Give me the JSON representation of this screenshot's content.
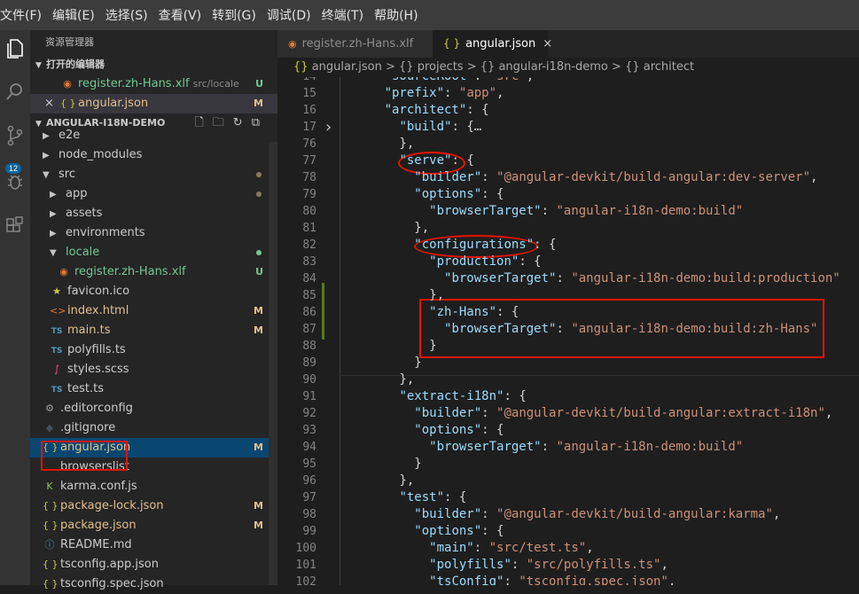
{
  "menu": [
    "文件(F)",
    "编辑(E)",
    "选择(S)",
    "查看(V)",
    "转到(G)",
    "调试(D)",
    "终端(T)",
    "帮助(H)"
  ],
  "activity_badge": "12",
  "sidebar": {
    "title": "资源管理器",
    "open_editors_label": "打开的编辑器",
    "open_editors": [
      {
        "icon": "rss-icon",
        "name": "register.zh-Hans.xlf",
        "path": "src/locale",
        "status": "U"
      },
      {
        "icon": "json-icon",
        "name": "angular.json",
        "status": "M"
      }
    ],
    "project_label": "ANGULAR-I18N-DEMO",
    "tree": [
      {
        "name": "e2e",
        "kind": "folder",
        "indent": 0
      },
      {
        "name": "node_modules",
        "kind": "folder",
        "indent": 0
      },
      {
        "name": "src",
        "kind": "folder-open",
        "indent": 0,
        "dot": "#8b7a55"
      },
      {
        "name": "app",
        "kind": "folder",
        "indent": 1,
        "dot": "#8b7a55"
      },
      {
        "name": "assets",
        "kind": "folder",
        "indent": 1
      },
      {
        "name": "environments",
        "kind": "folder",
        "indent": 1
      },
      {
        "name": "locale",
        "kind": "folder-open",
        "indent": 1,
        "dot": "#73c991",
        "color": "#73c991"
      },
      {
        "name": "register.zh-Hans.xlf",
        "kind": "rss",
        "indent": 2,
        "status": "U",
        "color": "#73c991"
      },
      {
        "name": "favicon.ico",
        "kind": "star",
        "indent": 1
      },
      {
        "name": "index.html",
        "kind": "html",
        "indent": 1,
        "status": "M",
        "color": "#e2c08d"
      },
      {
        "name": "main.ts",
        "kind": "ts",
        "indent": 1,
        "status": "M",
        "color": "#e2c08d"
      },
      {
        "name": "polyfills.ts",
        "kind": "ts",
        "indent": 1
      },
      {
        "name": "styles.scss",
        "kind": "scss",
        "indent": 1
      },
      {
        "name": "test.ts",
        "kind": "ts",
        "indent": 1
      },
      {
        "name": ".editorconfig",
        "kind": "gear",
        "indent": 0
      },
      {
        "name": ".gitignore",
        "kind": "git",
        "indent": 0
      },
      {
        "name": "angular.json",
        "kind": "json",
        "indent": 0,
        "status": "M",
        "color": "#e2c08d",
        "selected": true
      },
      {
        "name": "browserslist",
        "kind": "plain",
        "indent": 0
      },
      {
        "name": "karma.conf.js",
        "kind": "karma",
        "indent": 0
      },
      {
        "name": "package-lock.json",
        "kind": "json",
        "indent": 0,
        "status": "M",
        "color": "#e2c08d"
      },
      {
        "name": "package.json",
        "kind": "json",
        "indent": 0,
        "status": "M",
        "color": "#e2c08d"
      },
      {
        "name": "README.md",
        "kind": "info",
        "indent": 0
      },
      {
        "name": "tsconfig.app.json",
        "kind": "json",
        "indent": 0
      },
      {
        "name": "tsconfig.spec.json",
        "kind": "json",
        "indent": 0
      }
    ]
  },
  "tabs": [
    {
      "name": "register.zh-Hans.xlf",
      "active": false
    },
    {
      "name": "angular.json",
      "active": true,
      "close": "×"
    }
  ],
  "breadcrumb": [
    "angular.json",
    "projects",
    "angular-i18n-demo",
    "architect"
  ],
  "breadcrumb_sep": ">",
  "breadcrumb_brace": "{}",
  "code_lines": [
    {
      "n": "14",
      "t": "      \"sourceRoot\": \"src\","
    },
    {
      "n": "15",
      "t": "      \"prefix\": \"app\","
    },
    {
      "n": "16",
      "t": "      \"architect\": {"
    },
    {
      "n": "17",
      "t": "        \"build\": {…",
      "fold": true
    },
    {
      "n": "76",
      "t": "        },"
    },
    {
      "n": "77",
      "t": "        \"serve\": {"
    },
    {
      "n": "78",
      "t": "          \"builder\": \"@angular-devkit/build-angular:dev-server\","
    },
    {
      "n": "79",
      "t": "          \"options\": {"
    },
    {
      "n": "80",
      "t": "            \"browserTarget\": \"angular-i18n-demo:build\""
    },
    {
      "n": "81",
      "t": "          },"
    },
    {
      "n": "82",
      "t": "          \"configurations\": {"
    },
    {
      "n": "83",
      "t": "            \"production\": {"
    },
    {
      "n": "84",
      "t": "              \"browserTarget\": \"angular-i18n-demo:build:production\""
    },
    {
      "n": "85",
      "t": "            },"
    },
    {
      "n": "86",
      "t": "            \"zh-Hans\": {"
    },
    {
      "n": "87",
      "t": "              \"browserTarget\": \"angular-i18n-demo:build:zh-Hans\""
    },
    {
      "n": "88",
      "t": "            }"
    },
    {
      "n": "89",
      "t": "          }"
    },
    {
      "n": "90",
      "t": "        },"
    },
    {
      "n": "91",
      "t": "        \"extract-i18n\": {"
    },
    {
      "n": "92",
      "t": "          \"builder\": \"@angular-devkit/build-angular:extract-i18n\","
    },
    {
      "n": "93",
      "t": "          \"options\": {"
    },
    {
      "n": "94",
      "t": "            \"browserTarget\": \"angular-i18n-demo:build\""
    },
    {
      "n": "95",
      "t": "          }"
    },
    {
      "n": "96",
      "t": "        },"
    },
    {
      "n": "97",
      "t": "        \"test\": {"
    },
    {
      "n": "98",
      "t": "          \"builder\": \"@angular-devkit/build-angular:karma\","
    },
    {
      "n": "99",
      "t": "          \"options\": {"
    },
    {
      "n": "100",
      "t": "            \"main\": \"src/test.ts\","
    },
    {
      "n": "101",
      "t": "            \"polyfills\": \"src/polyfills.ts\","
    },
    {
      "n": "102",
      "t": "            \"tsConfig\": \"tsconfig.spec.json\","
    }
  ],
  "colors": {
    "accent": "#007acc",
    "annotation": "#e51400",
    "modified": "#e2c08d",
    "untracked": "#73c991"
  }
}
